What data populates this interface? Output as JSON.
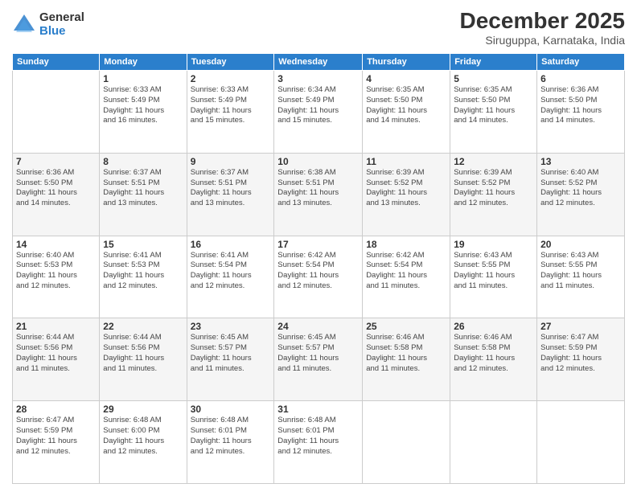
{
  "logo": {
    "general": "General",
    "blue": "Blue"
  },
  "header": {
    "month": "December 2025",
    "location": "Siruguppa, Karnataka, India"
  },
  "weekdays": [
    "Sunday",
    "Monday",
    "Tuesday",
    "Wednesday",
    "Thursday",
    "Friday",
    "Saturday"
  ],
  "weeks": [
    [
      {
        "day": "",
        "info": ""
      },
      {
        "day": "1",
        "info": "Sunrise: 6:33 AM\nSunset: 5:49 PM\nDaylight: 11 hours\nand 16 minutes."
      },
      {
        "day": "2",
        "info": "Sunrise: 6:33 AM\nSunset: 5:49 PM\nDaylight: 11 hours\nand 15 minutes."
      },
      {
        "day": "3",
        "info": "Sunrise: 6:34 AM\nSunset: 5:49 PM\nDaylight: 11 hours\nand 15 minutes."
      },
      {
        "day": "4",
        "info": "Sunrise: 6:35 AM\nSunset: 5:50 PM\nDaylight: 11 hours\nand 14 minutes."
      },
      {
        "day": "5",
        "info": "Sunrise: 6:35 AM\nSunset: 5:50 PM\nDaylight: 11 hours\nand 14 minutes."
      },
      {
        "day": "6",
        "info": "Sunrise: 6:36 AM\nSunset: 5:50 PM\nDaylight: 11 hours\nand 14 minutes."
      }
    ],
    [
      {
        "day": "7",
        "info": "Sunrise: 6:36 AM\nSunset: 5:50 PM\nDaylight: 11 hours\nand 14 minutes."
      },
      {
        "day": "8",
        "info": "Sunrise: 6:37 AM\nSunset: 5:51 PM\nDaylight: 11 hours\nand 13 minutes."
      },
      {
        "day": "9",
        "info": "Sunrise: 6:37 AM\nSunset: 5:51 PM\nDaylight: 11 hours\nand 13 minutes."
      },
      {
        "day": "10",
        "info": "Sunrise: 6:38 AM\nSunset: 5:51 PM\nDaylight: 11 hours\nand 13 minutes."
      },
      {
        "day": "11",
        "info": "Sunrise: 6:39 AM\nSunset: 5:52 PM\nDaylight: 11 hours\nand 13 minutes."
      },
      {
        "day": "12",
        "info": "Sunrise: 6:39 AM\nSunset: 5:52 PM\nDaylight: 11 hours\nand 12 minutes."
      },
      {
        "day": "13",
        "info": "Sunrise: 6:40 AM\nSunset: 5:52 PM\nDaylight: 11 hours\nand 12 minutes."
      }
    ],
    [
      {
        "day": "14",
        "info": "Sunrise: 6:40 AM\nSunset: 5:53 PM\nDaylight: 11 hours\nand 12 minutes."
      },
      {
        "day": "15",
        "info": "Sunrise: 6:41 AM\nSunset: 5:53 PM\nDaylight: 11 hours\nand 12 minutes."
      },
      {
        "day": "16",
        "info": "Sunrise: 6:41 AM\nSunset: 5:54 PM\nDaylight: 11 hours\nand 12 minutes."
      },
      {
        "day": "17",
        "info": "Sunrise: 6:42 AM\nSunset: 5:54 PM\nDaylight: 11 hours\nand 12 minutes."
      },
      {
        "day": "18",
        "info": "Sunrise: 6:42 AM\nSunset: 5:54 PM\nDaylight: 11 hours\nand 11 minutes."
      },
      {
        "day": "19",
        "info": "Sunrise: 6:43 AM\nSunset: 5:55 PM\nDaylight: 11 hours\nand 11 minutes."
      },
      {
        "day": "20",
        "info": "Sunrise: 6:43 AM\nSunset: 5:55 PM\nDaylight: 11 hours\nand 11 minutes."
      }
    ],
    [
      {
        "day": "21",
        "info": "Sunrise: 6:44 AM\nSunset: 5:56 PM\nDaylight: 11 hours\nand 11 minutes."
      },
      {
        "day": "22",
        "info": "Sunrise: 6:44 AM\nSunset: 5:56 PM\nDaylight: 11 hours\nand 11 minutes."
      },
      {
        "day": "23",
        "info": "Sunrise: 6:45 AM\nSunset: 5:57 PM\nDaylight: 11 hours\nand 11 minutes."
      },
      {
        "day": "24",
        "info": "Sunrise: 6:45 AM\nSunset: 5:57 PM\nDaylight: 11 hours\nand 11 minutes."
      },
      {
        "day": "25",
        "info": "Sunrise: 6:46 AM\nSunset: 5:58 PM\nDaylight: 11 hours\nand 11 minutes."
      },
      {
        "day": "26",
        "info": "Sunrise: 6:46 AM\nSunset: 5:58 PM\nDaylight: 11 hours\nand 12 minutes."
      },
      {
        "day": "27",
        "info": "Sunrise: 6:47 AM\nSunset: 5:59 PM\nDaylight: 11 hours\nand 12 minutes."
      }
    ],
    [
      {
        "day": "28",
        "info": "Sunrise: 6:47 AM\nSunset: 5:59 PM\nDaylight: 11 hours\nand 12 minutes."
      },
      {
        "day": "29",
        "info": "Sunrise: 6:48 AM\nSunset: 6:00 PM\nDaylight: 11 hours\nand 12 minutes."
      },
      {
        "day": "30",
        "info": "Sunrise: 6:48 AM\nSunset: 6:01 PM\nDaylight: 11 hours\nand 12 minutes."
      },
      {
        "day": "31",
        "info": "Sunrise: 6:48 AM\nSunset: 6:01 PM\nDaylight: 11 hours\nand 12 minutes."
      },
      {
        "day": "",
        "info": ""
      },
      {
        "day": "",
        "info": ""
      },
      {
        "day": "",
        "info": ""
      }
    ]
  ]
}
